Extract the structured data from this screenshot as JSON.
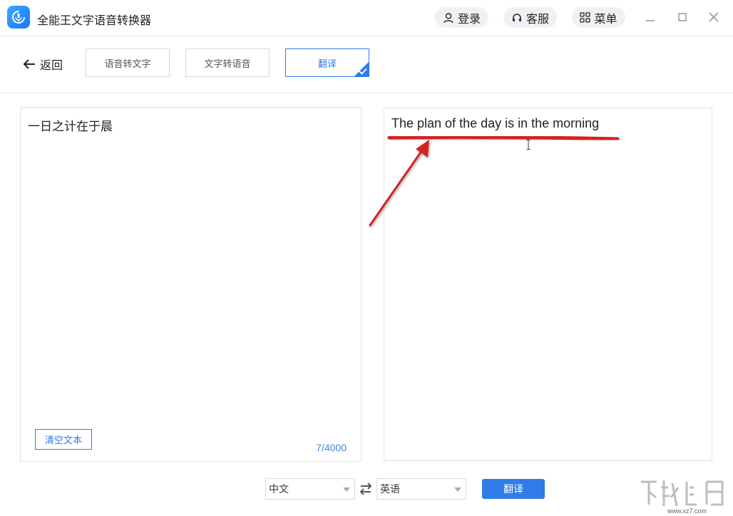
{
  "window": {
    "title": "全能王文字语音转换器",
    "login_label": "登录",
    "service_label": "客服",
    "menu_label": "菜单"
  },
  "toolbar": {
    "back_label": "返回",
    "tabs": [
      {
        "label": "语音转文字",
        "active": false
      },
      {
        "label": "文字转语音",
        "active": false
      },
      {
        "label": "翻译",
        "active": true
      }
    ]
  },
  "source_panel": {
    "text": "一日之计在于晨",
    "clear_label": "清空文本",
    "char_count": "7/4000"
  },
  "result_panel": {
    "text": "The plan of the day is in the morning"
  },
  "controls": {
    "source_lang": "中文",
    "target_lang": "英语",
    "translate_label": "翻译"
  },
  "watermark": {
    "site": "www.xz7.com"
  },
  "colors": {
    "accent": "#2f7be8",
    "annotation": "#d42020"
  }
}
